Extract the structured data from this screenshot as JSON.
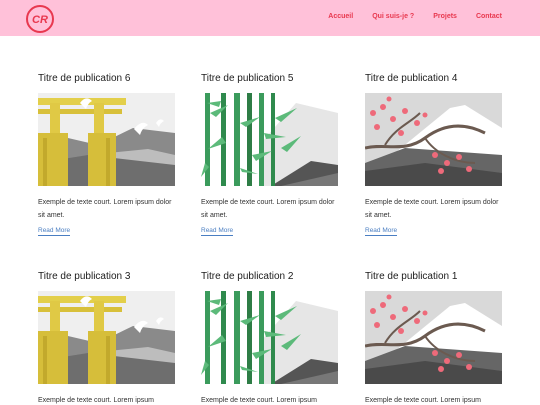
{
  "header": {
    "logo_text": "CR",
    "nav": [
      {
        "label": "Accueil"
      },
      {
        "label": "Qui suis-je ?"
      },
      {
        "label": "Projets"
      },
      {
        "label": "Contact"
      }
    ]
  },
  "colors": {
    "header_bg": "#ffc1d9",
    "accent": "#e8384f",
    "link": "#4a7ec2"
  },
  "posts": [
    {
      "title": "Titre de publication 6",
      "image": "torii-gate",
      "excerpt": "Exemple de texte court. Lorem ipsum dolor sit amet.",
      "link": "Read More"
    },
    {
      "title": "Titre de publication 5",
      "image": "bamboo",
      "excerpt": "Exemple de texte court. Lorem ipsum dolor sit amet.",
      "link": "Read More"
    },
    {
      "title": "Titre de publication 4",
      "image": "cherry-blossom",
      "excerpt": "Exemple de texte court. Lorem ipsum dolor sit amet.",
      "link": "Read More"
    },
    {
      "title": "Titre de publication 3",
      "image": "torii-gate",
      "excerpt": "Exemple de texte court. Lorem ipsum",
      "link": ""
    },
    {
      "title": "Titre de publication 2",
      "image": "bamboo",
      "excerpt": "Exemple de texte court. Lorem ipsum",
      "link": ""
    },
    {
      "title": "Titre de publication 1",
      "image": "cherry-blossom",
      "excerpt": "Exemple de texte court. Lorem ipsum",
      "link": ""
    }
  ]
}
